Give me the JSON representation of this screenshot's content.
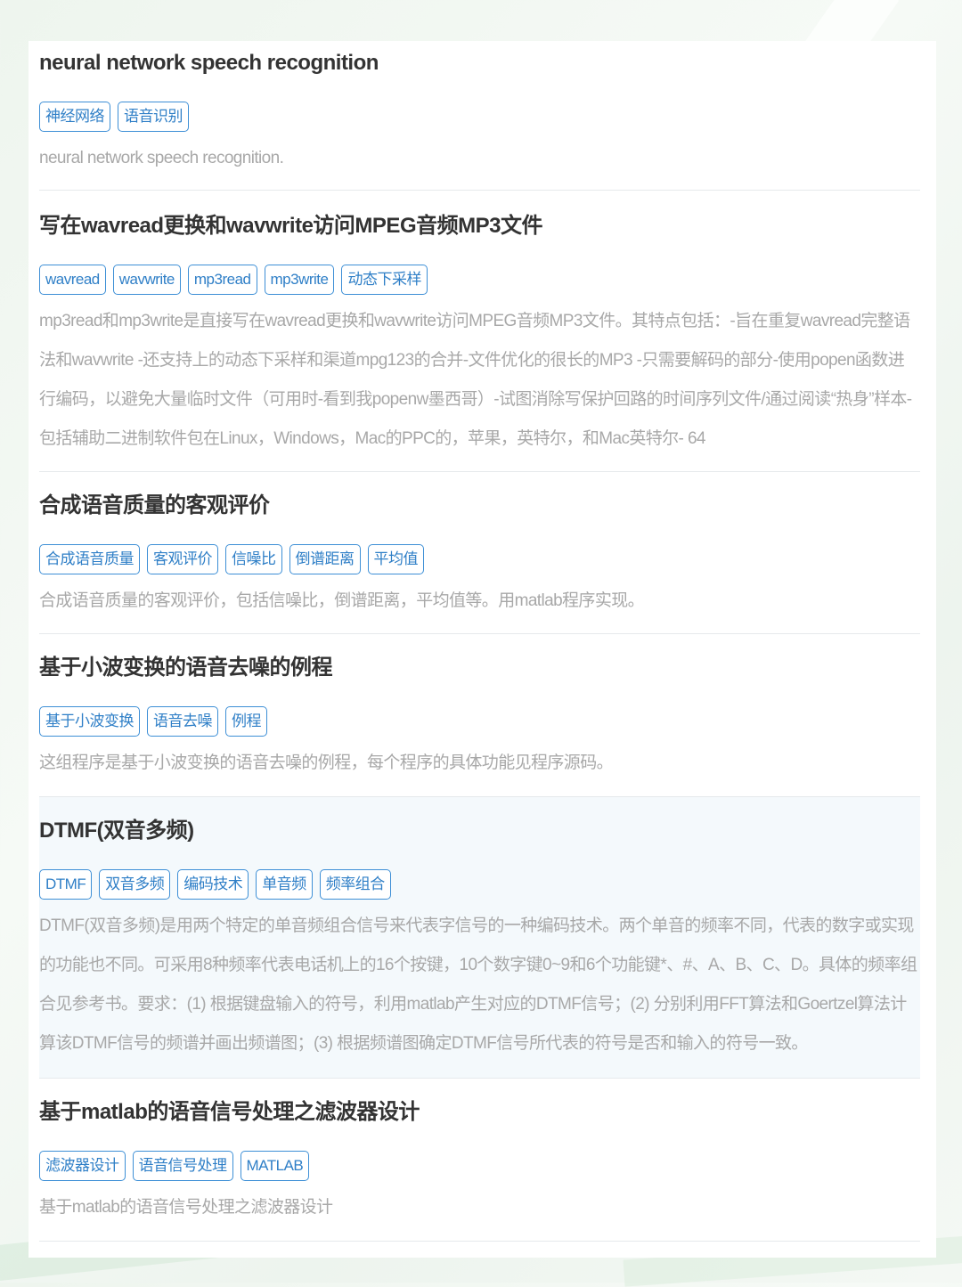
{
  "entries": [
    {
      "title": "neural network speech recognition",
      "tags": [
        "神经网络",
        "语音识别"
      ],
      "description": "neural network speech recognition."
    },
    {
      "title": "写在wavread更换和wavwrite访问MPEG音频MP3文件",
      "tags": [
        "wavread",
        "wavwrite",
        "mp3read",
        "mp3write",
        "动态下采样"
      ],
      "description": "mp3read和mp3write是直接写在wavread更换和wavwrite访问MPEG音频MP3文件。其特点包括：-旨在重复wavread完整语法和wavwrite -还支持上的动态下采样和渠道mpg123的合并-文件优化的很长的MP3 -只需要解码的部分-使用popen函数进行编码，以避免大量临时文件（可用时-看到我popenw墨西哥）-试图消除写保护回路的时间序列文件/通过阅读“热身”样本-包括辅助二进制软件包在Linux，Windows，Mac的PPC的，苹果，英特尔，和Mac英特尔- 64"
    },
    {
      "title": "合成语音质量的客观评价",
      "tags": [
        "合成语音质量",
        "客观评价",
        "信噪比",
        "倒谱距离",
        "平均值"
      ],
      "description": "合成语音质量的客观评价，包括信噪比，倒谱距离，平均值等。用matlab程序实现。"
    },
    {
      "title": "基于小波变换的语音去噪的例程",
      "tags": [
        "基于小波变换",
        "语音去噪",
        "例程"
      ],
      "description": "这组程序是基于小波变换的语音去噪的例程，每个程序的具体功能见程序源码。"
    },
    {
      "title": "DTMF(双音多频)",
      "tags": [
        "DTMF",
        "双音多频",
        "编码技术",
        "单音频",
        "频率组合"
      ],
      "description": "DTMF(双音多频)是用两个特定的单音频组合信号来代表字信号的一种编码技术。两个单音的频率不同，代表的数字或实现的功能也不同。可采用8种频率代表电话机上的16个按键，10个数字键0~9和6个功能键*、#、A、B、C、D。具体的频率组合见参考书。要求：(1) 根据键盘输入的符号，利用matlab产生对应的DTMF信号；(2) 分别利用FFT算法和Goertzel算法计算该DTMF信号的频谱并画出频谱图；(3) 根据频谱图确定DTMF信号所代表的符号是否和输入的符号一致。"
    },
    {
      "title": "基于matlab的语音信号处理之滤波器设计",
      "tags": [
        "滤波器设计",
        "语音信号处理",
        "MATLAB"
      ],
      "description": "基于matlab的语音信号处理之滤波器设计"
    }
  ]
}
